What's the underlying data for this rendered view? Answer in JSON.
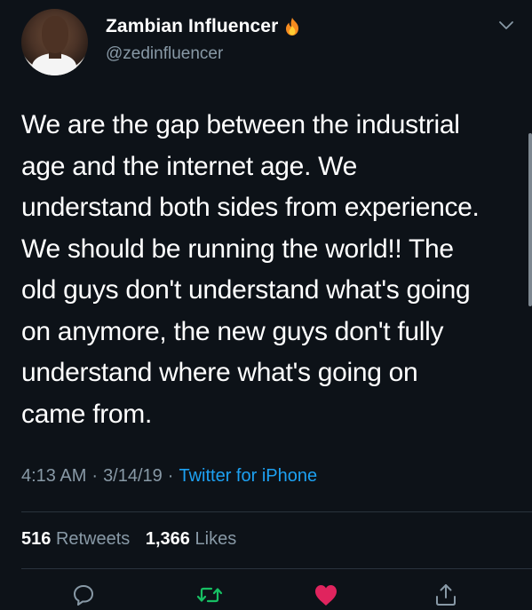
{
  "tweet": {
    "author": {
      "display_name": "Zambian Influencer",
      "handle": "@zedinfluencer",
      "name_emoji": "fire-icon"
    },
    "text": "We are the gap between the industrial\nage and the internet age. We\nunderstand both sides from experience.\nWe should be running the world!! The\nold guys don't understand what's going\non anymore, the new guys don't fully\nunderstand where what's going on\ncame from.",
    "time": "4:13 AM",
    "separator": "·",
    "date": "3/14/19",
    "source": "Twitter for iPhone",
    "stats": {
      "retweets_count": "516",
      "retweets_label": "Retweets",
      "likes_count": "1,366",
      "likes_label": "Likes"
    },
    "actions": [
      "reply-icon",
      "retweet-icon",
      "like-icon",
      "share-icon"
    ]
  },
  "colors": {
    "background": "#0d1218",
    "text_primary": "#ffffff",
    "text_secondary": "#8899a6",
    "link": "#1da1f2",
    "retweet": "#17bf63",
    "like": "#e0245e"
  }
}
